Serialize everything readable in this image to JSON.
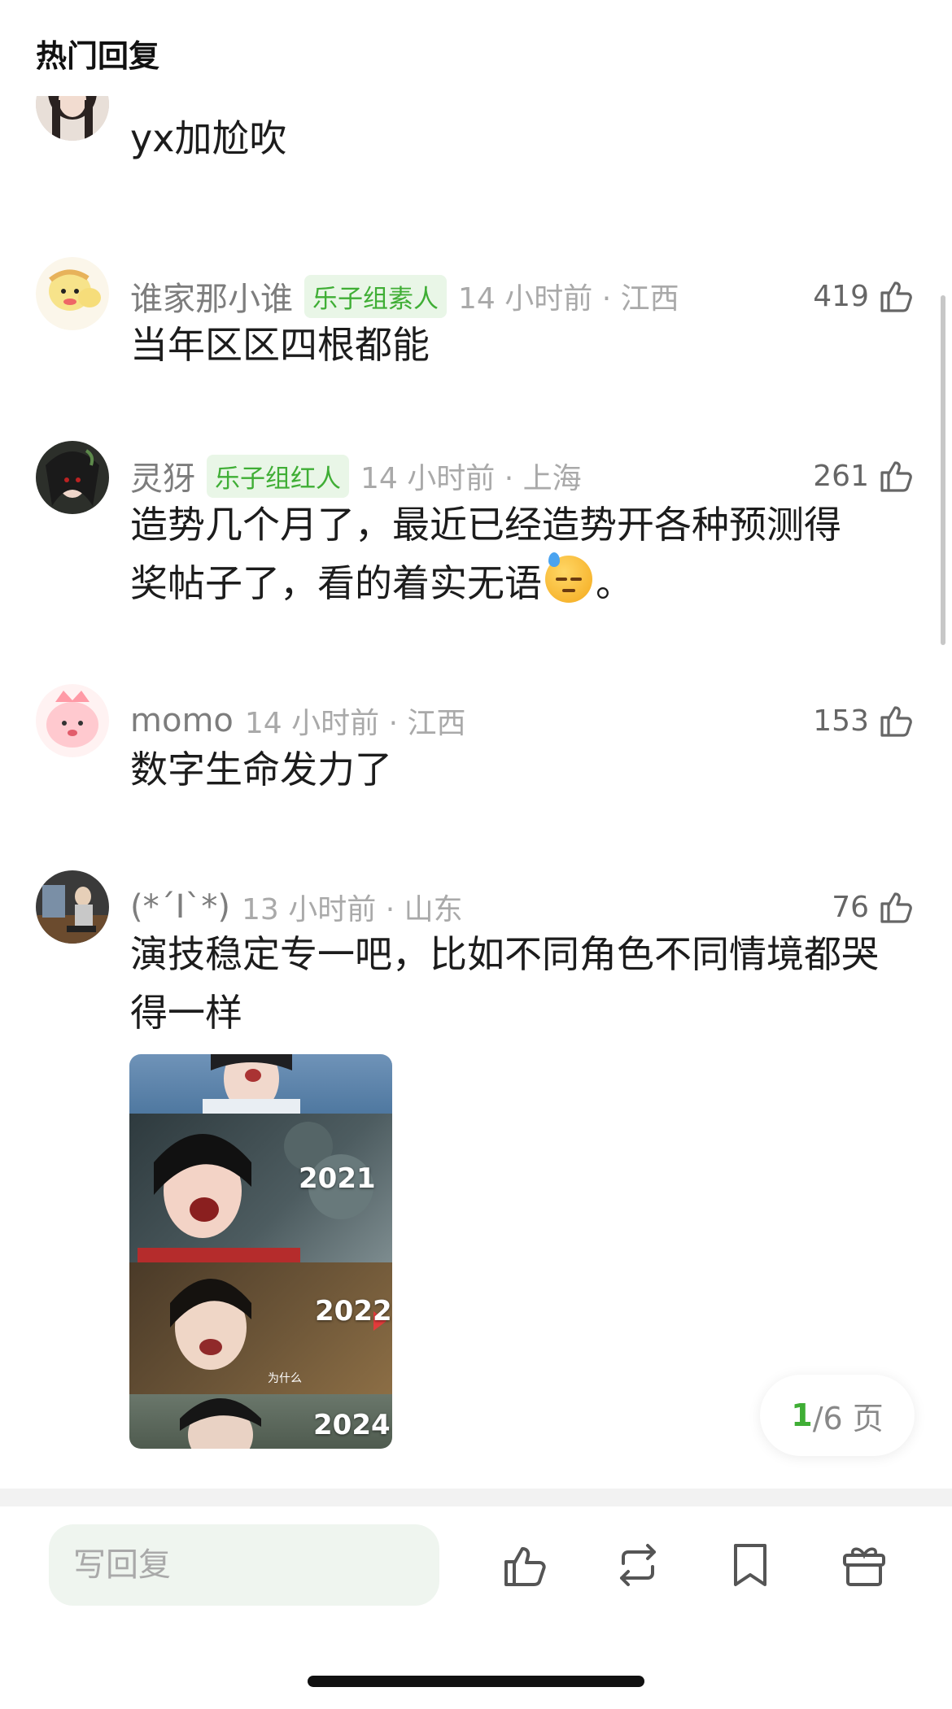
{
  "header": {
    "title": "热门回复"
  },
  "comments": [
    {
      "username": "",
      "badge": "",
      "time": "",
      "likes": "",
      "text": "yx加尬吹"
    },
    {
      "username": "谁家那小谁",
      "badge": "乐子组素人",
      "time": "14 小时前 · 江西",
      "likes": "419",
      "text": "当年区区四根都能"
    },
    {
      "username": "灵犽",
      "badge": "乐子组红人",
      "time": "14 小时前 · 上海",
      "likes": "261",
      "text_line1": "造势几个月了，最近已经造势开各种预测得",
      "text_line2a": "奖帖子了，看的着实无语",
      "text_line2b": "。"
    },
    {
      "username": "momo",
      "badge": "",
      "time": "14 小时前 · 江西",
      "likes": "153",
      "text": "数字生命发力了"
    },
    {
      "username": "(*´I`*)",
      "badge": "",
      "time": "13 小时前 · 山东",
      "likes": "76",
      "text": "演技稳定专一吧，比如不同角色不同情境都哭得一样",
      "image_captions": [
        "2021",
        "2022",
        "为什么",
        "2024"
      ]
    }
  ],
  "pager": {
    "current": "1",
    "total": "/6 页"
  },
  "bottom_bar": {
    "reply_placeholder": "写回复"
  },
  "colors": {
    "accent": "#3fae35",
    "badge_bg": "#e9f6e7"
  },
  "icons": [
    "thumb-up-icon",
    "repost-icon",
    "bookmark-icon",
    "gift-icon"
  ]
}
